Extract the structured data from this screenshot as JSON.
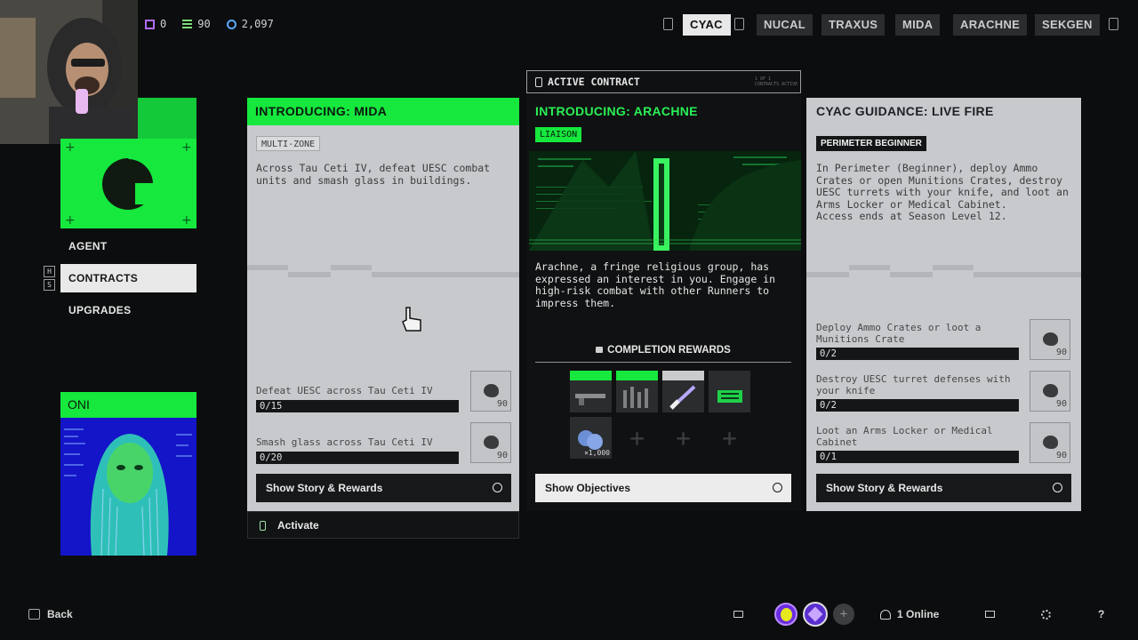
{
  "topbar": {
    "currencies": [
      {
        "icon": "currency-purple-icon",
        "value": "0",
        "color": "#b36bff"
      },
      {
        "icon": "currency-green-icon",
        "value": "90",
        "color": "#7ddf7a"
      },
      {
        "icon": "currency-blue-icon",
        "value": "2,097",
        "color": "#5aa8ff"
      }
    ],
    "factions": [
      "CYAC",
      "NUCAL",
      "TRAXUS",
      "MIDA",
      "ARACHNE",
      "SEKGEN"
    ],
    "active_faction": "CYAC"
  },
  "sidebar": {
    "items": [
      {
        "label": "AGENT"
      },
      {
        "label": "CONTRACTS"
      },
      {
        "label": "UPGRADES"
      }
    ],
    "key_hints": [
      "H",
      "S"
    ],
    "agent_card": {
      "name": "ONI"
    }
  },
  "cards": {
    "mida": {
      "title": "INTRODUCING: MIDA",
      "tag": "MULTI-ZONE",
      "description": "Across Tau Ceti IV, defeat UESC combat units and smash glass in buildings.",
      "objectives": [
        {
          "text": "Defeat UESC across Tau Ceti IV",
          "progress": "0/15",
          "reward": "90"
        },
        {
          "text": "Smash glass across Tau Ceti IV",
          "progress": "0/20",
          "reward": "90"
        }
      ],
      "button": "Show Story & Rewards",
      "activate": "Activate"
    },
    "arachne": {
      "banner": "ACTIVE CONTRACT",
      "banner_note": "1 OF 1\nCONTRACTS ACTIVE",
      "title": "INTRODUCING: ARACHNE",
      "tag": "LIAISON",
      "description": "Arachne, a fringe religious group, has expressed an interest in you. Engage in high-risk combat with other Runners to impress them.",
      "rewards_heading": "COMPLETION REWARDS",
      "reward_count": "×1,000",
      "button": "Show Objectives"
    },
    "cyac": {
      "title": "CYAC GUIDANCE: LIVE FIRE",
      "tag": "PERIMETER BEGINNER",
      "description": "In Perimeter (Beginner), deploy Ammo Crates or open Munitions Crates, destroy UESC turrets with your knife, and loot an Arms Locker or Medical Cabinet.\nAccess ends at Season Level 12.",
      "objectives": [
        {
          "text": "Deploy Ammo Crates or loot a Munitions Crate",
          "progress": "0/2",
          "reward": "90"
        },
        {
          "text": "Destroy UESC turret defenses with your knife",
          "progress": "0/2",
          "reward": "90"
        },
        {
          "text": "Loot an Arms Locker or Medical Cabinet",
          "progress": "0/1",
          "reward": "90"
        }
      ],
      "button": "Show Story & Rewards"
    }
  },
  "bottombar": {
    "back": "Back",
    "online": "1 Online"
  },
  "colors": {
    "accent": "#16e83e",
    "card_bg": "#c8c9cc",
    "bg": "#0c0d0e"
  }
}
